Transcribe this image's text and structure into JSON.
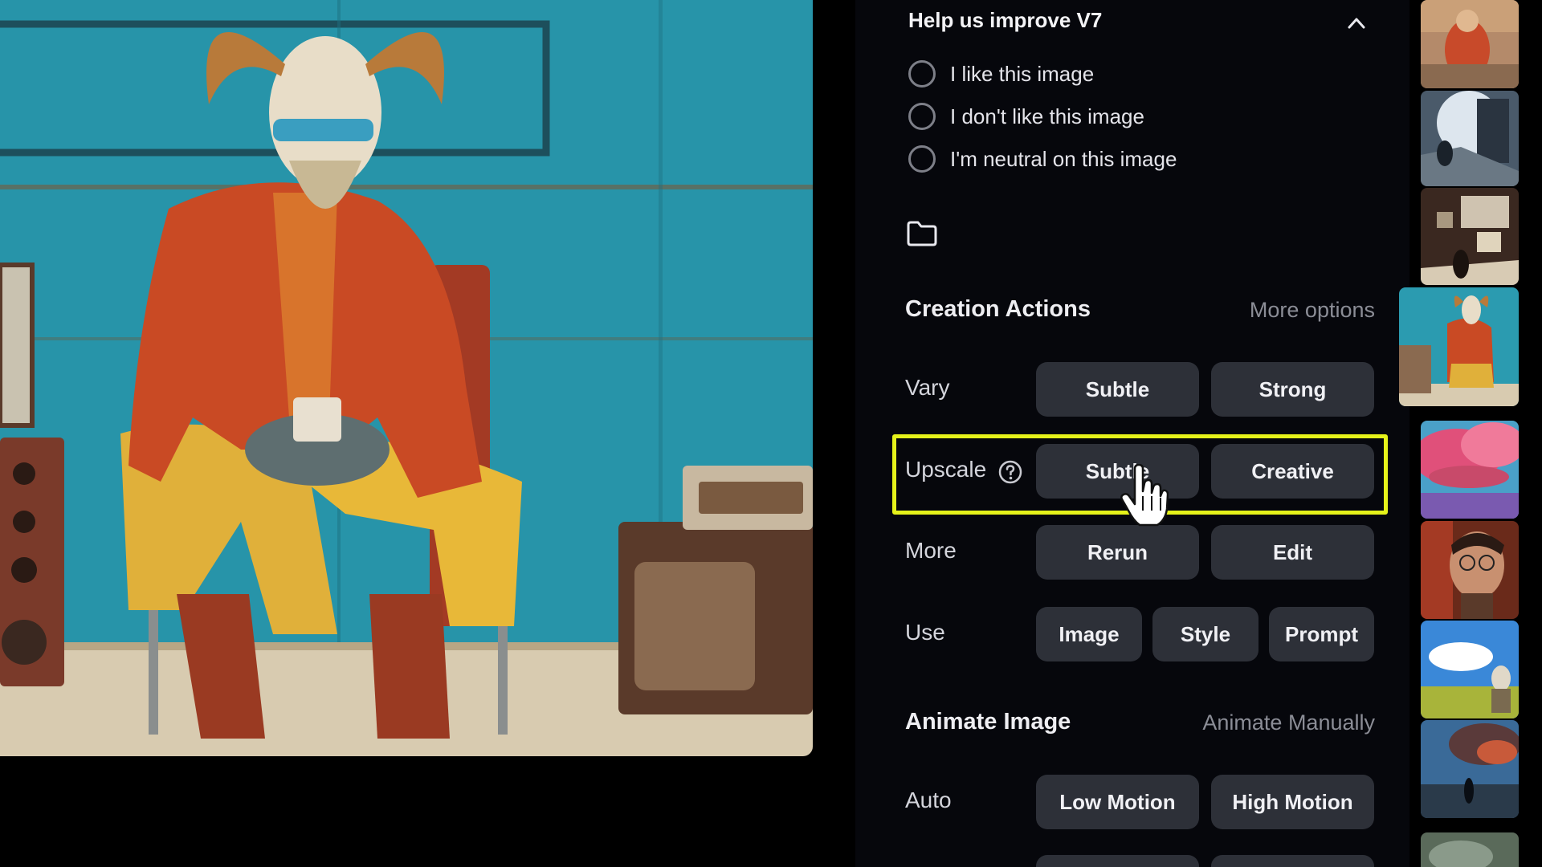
{
  "feedback": {
    "title": "Help us improve V7",
    "options": [
      "I like this image",
      "I don't like this image",
      "I'm neutral on this image"
    ]
  },
  "creation_actions": {
    "title": "Creation Actions",
    "more_options": "More options",
    "rows": {
      "vary": {
        "label": "Vary",
        "buttons": [
          "Subtle",
          "Strong"
        ]
      },
      "upscale": {
        "label": "Upscale",
        "buttons": [
          "Subtle",
          "Creative"
        ]
      },
      "more": {
        "label": "More",
        "buttons": [
          "Rerun",
          "Edit"
        ]
      },
      "use": {
        "label": "Use",
        "buttons": [
          "Image",
          "Style",
          "Prompt"
        ]
      }
    }
  },
  "animate": {
    "title": "Animate Image",
    "manual_link": "Animate Manually",
    "rows": {
      "auto": {
        "label": "Auto",
        "buttons": [
          "Low Motion",
          "High Motion"
        ]
      }
    }
  },
  "colors": {
    "highlight": "#e5f21a",
    "button_bg": "#2d3038",
    "panel_bg": "#06070c"
  },
  "icons": [
    "chevron-up-icon",
    "folder-icon",
    "help-circle-icon",
    "hand-pointer-icon"
  ]
}
